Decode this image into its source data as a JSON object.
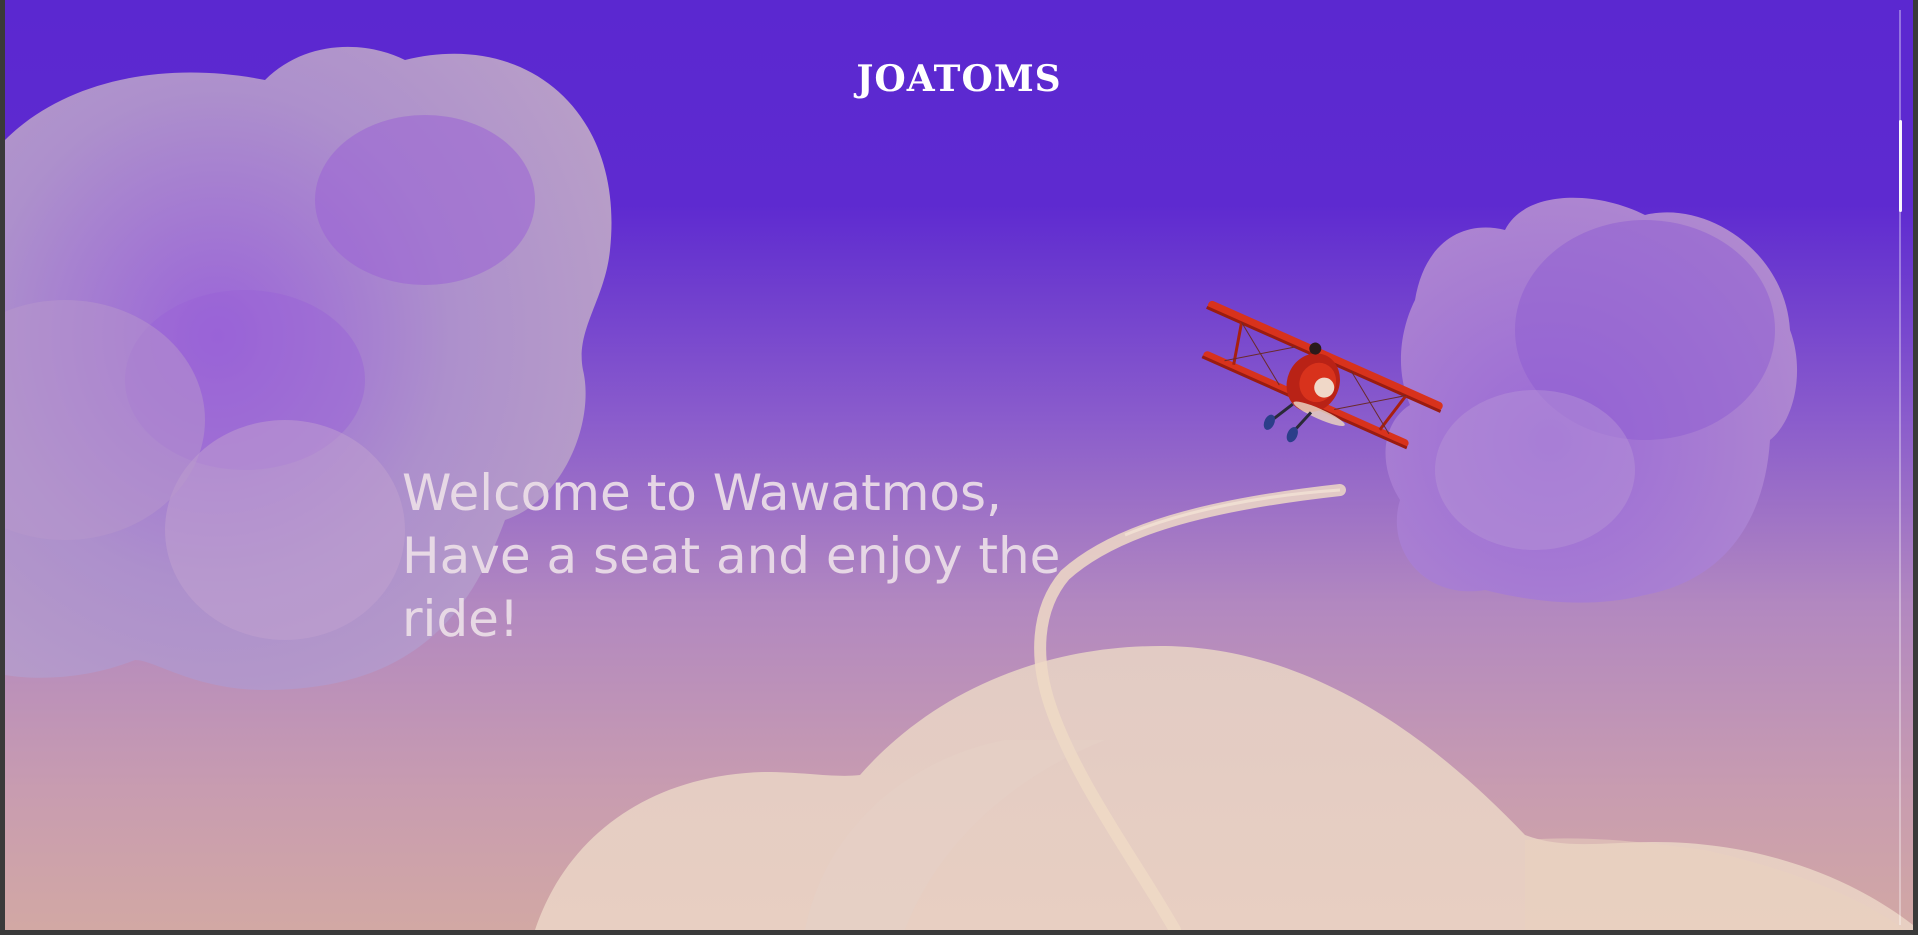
{
  "header": {
    "brand": "JOATOMS"
  },
  "hero": {
    "lines": [
      "Welcome to Wawatmos,",
      "Have a seat and enjoy the",
      "ride!"
    ]
  },
  "scene": {
    "sky_top": "#5b28d0",
    "sky_bottom": "#d2a8a4",
    "cloud_color": "#a888d8",
    "ground_cloud_color": "#e6cfc4",
    "plane_color": "#d8321c",
    "plane_icon": "biplane-icon",
    "trail_icon": "smoke-trail-icon"
  }
}
